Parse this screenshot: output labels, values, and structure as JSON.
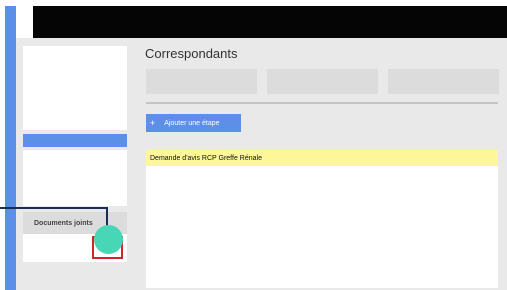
{
  "header": {
    "title": "Correspondants"
  },
  "toolbar": {
    "add_step_label": "Ajouter une étape",
    "add_step_icon": "plus-icon"
  },
  "sidebar": {
    "documents_label": "Documents joints"
  },
  "list": {
    "items": [
      {
        "label": "Demande d'avis RCP Greffe Rénale"
      }
    ]
  },
  "colors": {
    "accent_blue": "#5b8fe8",
    "highlight_yellow": "#fdf79a",
    "callout_teal": "#47d6b6",
    "callout_red": "#d22525",
    "callout_line": "#1a2e55"
  }
}
